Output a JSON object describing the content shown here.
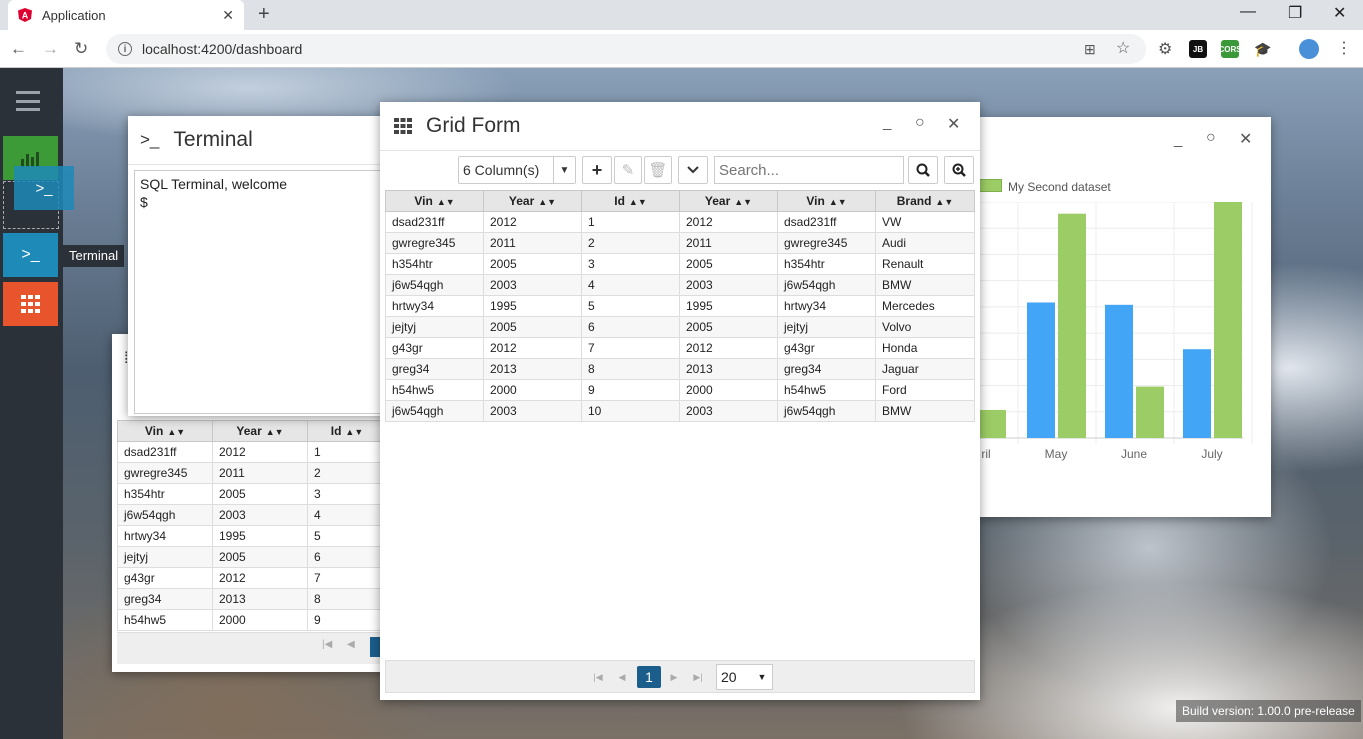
{
  "browser": {
    "tab_title": "Application",
    "url": "localhost:4200/dashboard",
    "extensions": [
      "JB",
      "CORS"
    ]
  },
  "sidebar": {
    "tooltip": "Terminal",
    "colors": {
      "chart": "#3d9b37",
      "terminal": "#1d8ab8",
      "grid": "#e8552d"
    }
  },
  "terminal": {
    "title": "Terminal",
    "prompt_icon": ">_",
    "output_line1": "SQL Terminal, welcome",
    "output_line2": "$"
  },
  "grid_form": {
    "title": "Grid Form",
    "columns_label": "6 Column(s)",
    "search_placeholder": "Search...",
    "headers": [
      "Vin",
      "Year",
      "Id",
      "Year",
      "Vin",
      "Brand"
    ],
    "rows": [
      [
        "dsad231ff",
        "2012",
        "1",
        "2012",
        "dsad231ff",
        "VW"
      ],
      [
        "gwregre345",
        "2011",
        "2",
        "2011",
        "gwregre345",
        "Audi"
      ],
      [
        "h354htr",
        "2005",
        "3",
        "2005",
        "h354htr",
        "Renault"
      ],
      [
        "j6w54qgh",
        "2003",
        "4",
        "2003",
        "j6w54qgh",
        "BMW"
      ],
      [
        "hrtwy34",
        "1995",
        "5",
        "1995",
        "hrtwy34",
        "Mercedes"
      ],
      [
        "jejtyj",
        "2005",
        "6",
        "2005",
        "jejtyj",
        "Volvo"
      ],
      [
        "g43gr",
        "2012",
        "7",
        "2012",
        "g43gr",
        "Honda"
      ],
      [
        "greg34",
        "2013",
        "8",
        "2013",
        "greg34",
        "Jaguar"
      ],
      [
        "h54hw5",
        "2000",
        "9",
        "2000",
        "h54hw5",
        "Ford"
      ],
      [
        "j6w54qgh",
        "2003",
        "10",
        "2003",
        "j6w54qgh",
        "BMW"
      ]
    ],
    "current_page": "1",
    "page_size": "20"
  },
  "back_grid": {
    "headers": [
      "Vin",
      "Year",
      "Id"
    ],
    "rows": [
      [
        "dsad231ff",
        "2012",
        "1"
      ],
      [
        "gwregre345",
        "2011",
        "2"
      ],
      [
        "h354htr",
        "2005",
        "3"
      ],
      [
        "j6w54qgh",
        "2003",
        "4"
      ],
      [
        "hrtwy34",
        "1995",
        "5"
      ],
      [
        "jejtyj",
        "2005",
        "6"
      ],
      [
        "g43gr",
        "2012",
        "7"
      ],
      [
        "greg34",
        "2013",
        "8"
      ],
      [
        "h54hw5",
        "2000",
        "9"
      ]
    ]
  },
  "chart_window": {
    "legend_label": "My Second dataset",
    "chart_data": {
      "type": "bar",
      "categories": [
        "ril",
        "May",
        "June",
        "July"
      ],
      "series": [
        {
          "name": "",
          "color": "#42a5f5",
          "values": [
            null,
            58,
            57,
            38
          ]
        },
        {
          "name": "My Second dataset",
          "color": "#9ccc65",
          "values": [
            12,
            96,
            22,
            101
          ]
        }
      ],
      "ylim": [
        0,
        101
      ],
      "grid": true
    }
  },
  "build_version": "Build version: 1.00.0 pre-release"
}
